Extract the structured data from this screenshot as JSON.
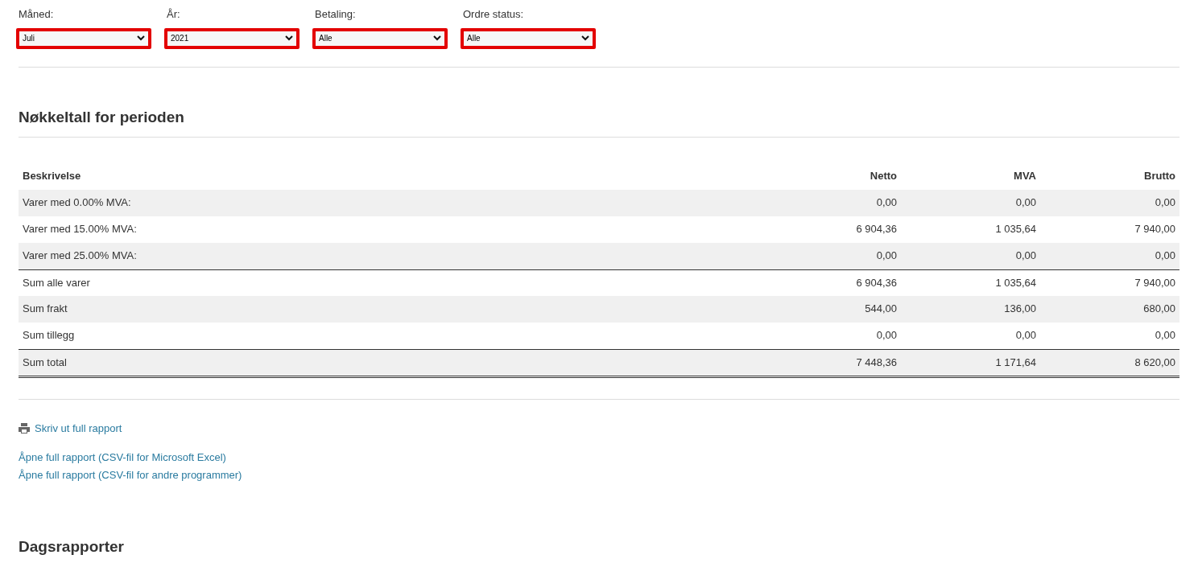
{
  "filters": [
    {
      "label": "Måned:",
      "value": "Juli"
    },
    {
      "label": "År:",
      "value": "2021"
    },
    {
      "label": "Betaling:",
      "value": "Alle"
    },
    {
      "label": "Ordre status:",
      "value": "Alle"
    }
  ],
  "summary": {
    "title": "Nøkkeltall for perioden",
    "table": {
      "columns": [
        "Beskrivelse",
        "Netto",
        "MVA",
        "Brutto"
      ],
      "rows": [
        {
          "cells": [
            "Varer med 0.00% MVA:",
            "0,00",
            "0,00",
            "0,00"
          ],
          "rule_above": false
        },
        {
          "cells": [
            "Varer med 15.00% MVA:",
            "6 904,36",
            "1 035,64",
            "7 940,00"
          ],
          "rule_above": false
        },
        {
          "cells": [
            "Varer med 25.00% MVA:",
            "0,00",
            "0,00",
            "0,00"
          ],
          "rule_above": false
        },
        {
          "cells": [
            "Sum alle varer",
            "6 904,36",
            "1 035,64",
            "7 940,00"
          ],
          "rule_above": true
        },
        {
          "cells": [
            "Sum frakt",
            "544,00",
            "136,00",
            "680,00"
          ],
          "rule_above": false
        },
        {
          "cells": [
            "Sum tillegg",
            "0,00",
            "0,00",
            "0,00"
          ],
          "rule_above": false
        },
        {
          "cells": [
            "Sum total",
            "7 448,36",
            "1 171,64",
            "8 620,00"
          ],
          "rule_above": true
        }
      ]
    }
  },
  "links": [
    {
      "label": "Skriv ut full rapport",
      "kind": "print"
    },
    {
      "label": "Åpne full rapport (CSV-fil for Microsoft Excel)",
      "kind": "plain"
    },
    {
      "label": "Åpne full rapport (CSV-fil for andre programmer)",
      "kind": "plain"
    }
  ],
  "daily": {
    "title": "Dagsrapporter"
  }
}
